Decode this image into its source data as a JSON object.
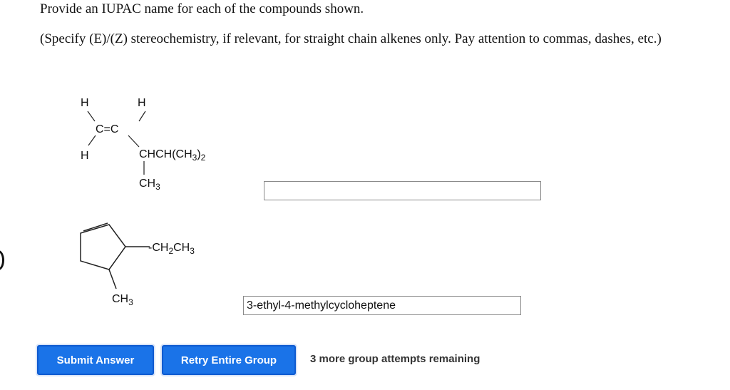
{
  "question": {
    "title": "Provide an IUPAC name for each of the compounds shown.",
    "instructions": "(Specify (E)/(Z) stereochemistry, if relevant, for straight chain alkenes only. Pay attention to commas, dashes, etc.)"
  },
  "compound1": {
    "h_top_left": "H",
    "h_top_right": "H",
    "h_bottom_left": "H",
    "alkene": "C=C",
    "substituent": "CHCH(CH",
    "substituent_sub": "3",
    "substituent_close": ")",
    "substituent_sub2": "2",
    "branch_ch": "CH",
    "branch_sub": "3",
    "answer_value": ""
  },
  "compound2": {
    "ethyl_text": "-CH",
    "ethyl_sub1": "2",
    "ethyl_mid": "CH",
    "ethyl_sub2": "3",
    "methyl_text": "CH",
    "methyl_sub": "3",
    "answer_value": "3-ethyl-4-methylcycloheptene"
  },
  "actions": {
    "submit_label": "Submit Answer",
    "retry_label": "Retry Entire Group",
    "attempts_text": "3 more group attempts remaining"
  },
  "colors": {
    "button_blue": "#1a73e8",
    "input_border": "#8a8a8a"
  }
}
